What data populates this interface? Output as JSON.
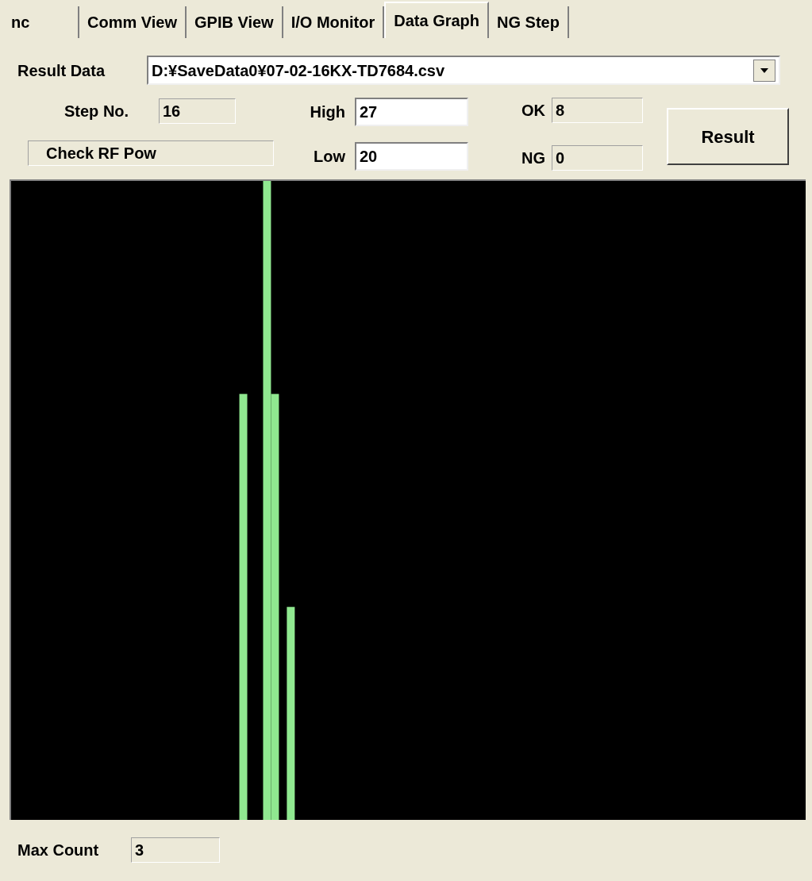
{
  "tabs": [
    {
      "label": "nc",
      "selected": false
    },
    {
      "label": "Comm View",
      "selected": false
    },
    {
      "label": "GPIB View",
      "selected": false
    },
    {
      "label": "I/O Monitor",
      "selected": false
    },
    {
      "label": "Data Graph",
      "selected": true
    },
    {
      "label": "NG Step",
      "selected": false
    }
  ],
  "result_data": {
    "label": "Result Data",
    "value": "D:¥SaveData0¥07-02-16KX-TD7684.csv"
  },
  "step_no": {
    "label": "Step No.",
    "value": "16",
    "read_only": true
  },
  "step_name": {
    "value": "Check RF Pow",
    "read_only": true
  },
  "high": {
    "label": "High",
    "value": "27",
    "read_only": false
  },
  "low": {
    "label": "Low",
    "value": "20",
    "read_only": false
  },
  "ok": {
    "label": "OK",
    "value": "8",
    "read_only": true
  },
  "ng": {
    "label": "NG",
    "value": "0",
    "read_only": true
  },
  "result_button": "Result",
  "max_count": {
    "label": "Max Count",
    "value": "3",
    "read_only": true
  }
}
